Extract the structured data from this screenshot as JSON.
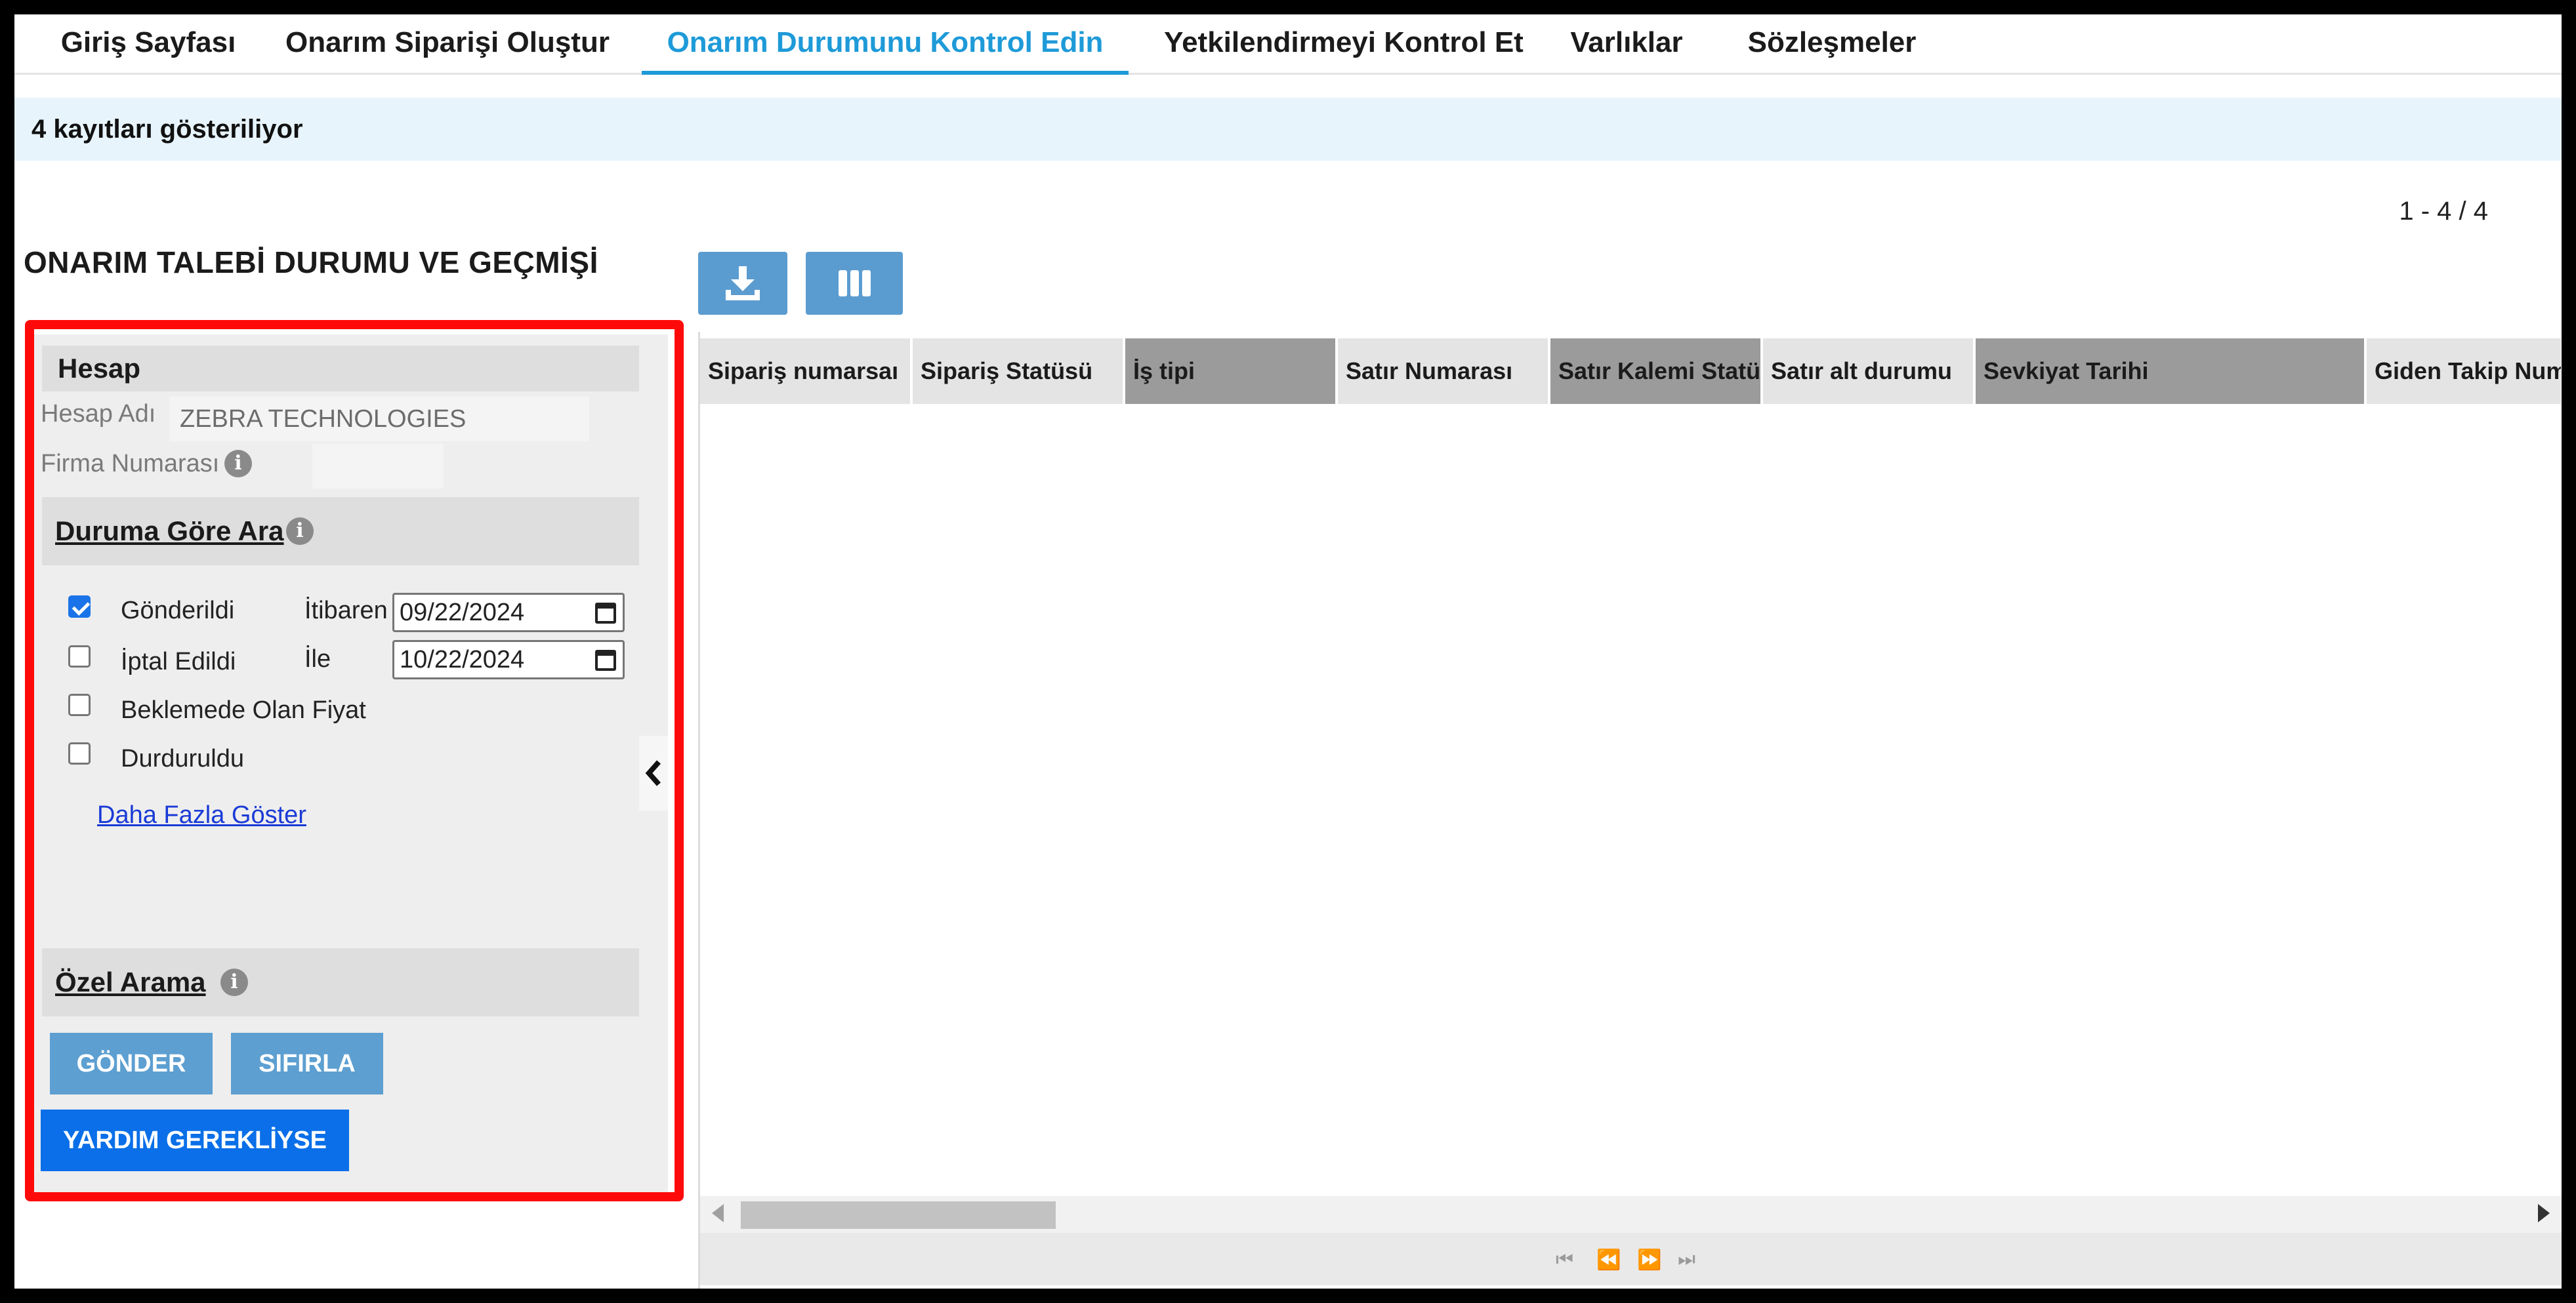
{
  "nav": {
    "items": [
      {
        "label": "Giriş Sayfası"
      },
      {
        "label": "Onarım Siparişi Oluştur"
      },
      {
        "label": "Onarım Durumunu Kontrol Edin"
      },
      {
        "label": "Yetkilendirmeyi Kontrol Et"
      },
      {
        "label": "Varlıklar"
      },
      {
        "label": "Sözleşmeler"
      }
    ],
    "active_color": "#1e9ad8"
  },
  "banner": {
    "text": "4 kayıtları gösteriliyor"
  },
  "pager_count": "1 - 4 / 4",
  "page_title": "ONARIM TALEBİ DURUMU VE GEÇMİŞİ",
  "account": {
    "section_title": "Hesap",
    "account_name_label": "Hesap Adı",
    "account_name_value": "ZEBRA TECHNOLOGIES",
    "company_number_label": "Firma Numarası",
    "company_number_value": ""
  },
  "status_search": {
    "title": "Duruma Göre Ara",
    "options": [
      {
        "label": "Gönderildi",
        "checked": true
      },
      {
        "label": "İptal Edildi",
        "checked": false
      },
      {
        "label": "Beklemede Olan Fiyat",
        "checked": false
      },
      {
        "label": "Durduruldu",
        "checked": false
      }
    ],
    "from_label": "İtibaren",
    "from_date": "09/22/2024",
    "to_label": "İle",
    "to_date": "10/22/2024",
    "more_link": "Daha Fazla Göster"
  },
  "custom_search": {
    "title": "Özel Arama"
  },
  "buttons": {
    "submit": "GÖNDER",
    "reset": "SIFIRLA",
    "help": "YARDIM GEREKLİYSE"
  },
  "toolbar": {
    "download_icon": "download-icon",
    "columns_icon": "columns-icon"
  },
  "grid": {
    "columns": [
      "Sipariş numarsaı",
      "Sipariş Statüsü",
      "İş tipi",
      "Satır Numarası",
      "Satır Kalemi Statüsü",
      "Satır alt durumu",
      "Sevkiyat Tarihi",
      "Giden Takip Numarası"
    ],
    "rows": []
  },
  "highlight_color": "#ff0a0a"
}
